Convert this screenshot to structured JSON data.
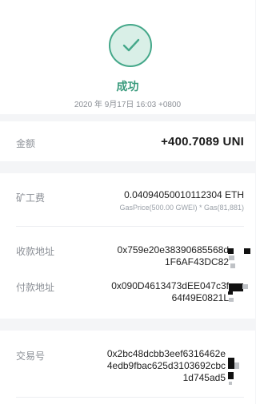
{
  "status": {
    "icon": "check-icon",
    "label": "成功",
    "time": "2020 年 9月17日 16:03 +0800",
    "accent": "#3a9b7d"
  },
  "amount": {
    "label": "金额",
    "value": "+400.7089 UNI"
  },
  "fee": {
    "label": "矿工费",
    "value": "0.04094050010112304 ETH",
    "detail": "GasPrice(500.00 GWEI) * Gas(81,881)"
  },
  "receiver": {
    "label": "收款地址",
    "value": "0x759e20e38390685568d\n1F6AF43DC82"
  },
  "sender": {
    "label": "付款地址",
    "value": "0x090D4613473dEE047c3f\n64f49E0821L"
  },
  "transaction": {
    "label": "交易号",
    "value": "0x2bc48dcbb3eef6316462e\n4edb9fbac625d3103692cbc\n1d745ad5"
  }
}
